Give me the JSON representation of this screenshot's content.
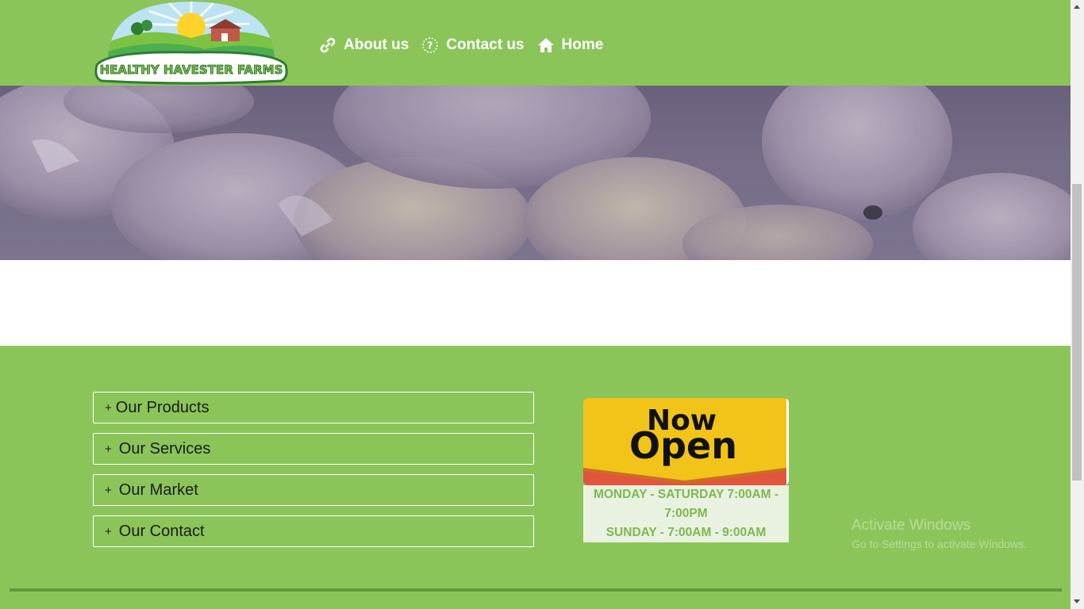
{
  "header": {
    "logo_text": "HEALTHY HAVESTER FARMS",
    "nav": [
      {
        "label": "About us",
        "icon": "link-icon"
      },
      {
        "label": "Contact us",
        "icon": "question-circle-icon"
      },
      {
        "label": "Home",
        "icon": "home-icon"
      }
    ]
  },
  "hero": {
    "image": "baby-chicks-photo"
  },
  "footer": {
    "accordion": [
      {
        "symbol": "+",
        "label": "Our Products"
      },
      {
        "symbol": "+",
        "label": "Our Services"
      },
      {
        "symbol": "+",
        "label": "Our Market"
      },
      {
        "symbol": "+",
        "label": "Our Contact"
      }
    ],
    "open_card": {
      "sign_line1": "Now",
      "sign_line2": "Open",
      "hours_line1": "MONDAY - SATURDAY 7:00AM -",
      "hours_line2": "7:00PM",
      "hours_line3": "SUNDAY - 7:00AM - 9:00AM"
    },
    "watermark": {
      "title": "Activate Windows",
      "subtitle": "Go to Settings to activate Windows."
    }
  },
  "colors": {
    "brand_green": "#8bc55a",
    "dark_green_line": "#5f9a3a",
    "hours_text": "#7cb950",
    "hours_bg": "#e9f2e0"
  }
}
